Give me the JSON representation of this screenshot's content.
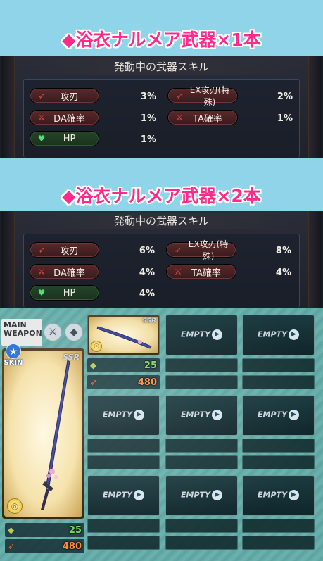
{
  "sections": [
    {
      "heading": "◆浴衣ナルメア武器×1本",
      "panel_title": "発動中の武器スキル",
      "skills": [
        {
          "label": "攻刃",
          "value": "3%",
          "icon": "sword-icon",
          "color": "red"
        },
        {
          "label": "EX攻刃(特殊)",
          "value": "2%",
          "icon": "sword-icon",
          "color": "red"
        },
        {
          "label": "DA確率",
          "value": "1%",
          "icon": "double-sword-icon",
          "color": "red"
        },
        {
          "label": "TA確率",
          "value": "1%",
          "icon": "double-sword-icon",
          "color": "red"
        },
        {
          "label": "HP",
          "value": "1%",
          "icon": "heart-icon",
          "color": "green"
        }
      ]
    },
    {
      "heading": "◆浴衣ナルメア武器×2本",
      "panel_title": "発動中の武器スキル",
      "skills": [
        {
          "label": "攻刃",
          "value": "6%",
          "icon": "sword-icon",
          "color": "red"
        },
        {
          "label": "EX攻刃(特殊)",
          "value": "8%",
          "icon": "sword-icon",
          "color": "red"
        },
        {
          "label": "DA確率",
          "value": "4%",
          "icon": "double-sword-icon",
          "color": "red"
        },
        {
          "label": "TA確率",
          "value": "4%",
          "icon": "double-sword-icon",
          "color": "red"
        },
        {
          "label": "HP",
          "value": "4%",
          "icon": "heart-icon",
          "color": "green"
        }
      ]
    }
  ],
  "weapon_grid": {
    "main_label_line1": "MAIN",
    "main_label_line2": "WEAPON",
    "skin_label": "SKIN",
    "rarity": "SSR",
    "main_stats": {
      "level": "25",
      "attack": "480"
    },
    "first_slot_stats": {
      "level": "25",
      "attack": "480"
    },
    "empty_label": "EMPTY",
    "colors": {
      "level": "#7ed957",
      "attack": "#ff8a3a"
    }
  }
}
